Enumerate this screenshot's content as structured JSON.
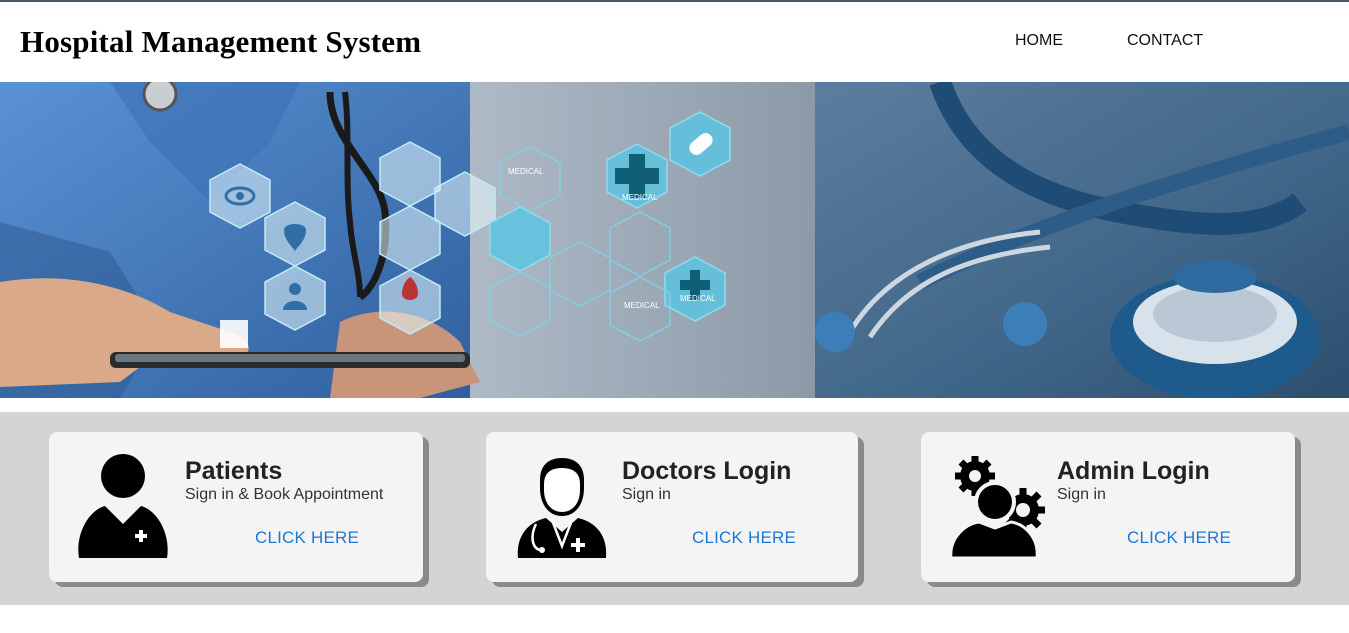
{
  "header": {
    "title": "Hospital Management System",
    "nav": [
      {
        "label": "HOME"
      },
      {
        "label": "CONTACT"
      }
    ]
  },
  "hero": {
    "hex_labels": [
      "MEDICAL",
      "MEDICAL",
      "MEDICAL",
      "MEDICAL"
    ]
  },
  "cards": [
    {
      "title": "Patients",
      "subtitle": "Sign in & Book Appointment",
      "link": "CLICK HERE",
      "icon": "patient-icon"
    },
    {
      "title": "Doctors Login",
      "subtitle": "Sign in",
      "link": "CLICK HERE",
      "icon": "doctor-icon"
    },
    {
      "title": "Admin Login",
      "subtitle": "Sign in",
      "link": "CLICK HERE",
      "icon": "admin-gears-icon"
    }
  ],
  "colors": {
    "link": "#1a78d6",
    "band": "#d4d4d4",
    "card": "#f4f4f4",
    "scrub_blue": "#4a7fc4",
    "hex_cyan": "#5fd0e8"
  }
}
